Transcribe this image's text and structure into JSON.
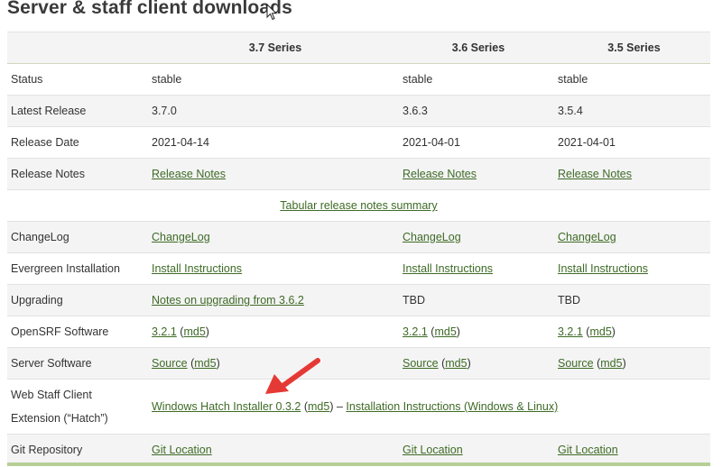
{
  "page": {
    "title": "Server & staff client downloads"
  },
  "table": {
    "columns": [
      "",
      "3.7 Series",
      "3.6 Series",
      "3.5 Series"
    ],
    "rows": {
      "status": {
        "label": "Status",
        "v37": "stable",
        "v36": "stable",
        "v35": "stable"
      },
      "latest_release": {
        "label": "Latest Release",
        "v37": "3.7.0",
        "v36": "3.6.3",
        "v35": "3.5.4"
      },
      "release_date": {
        "label": "Release Date",
        "v37": "2021-04-14",
        "v36": "2021-04-01",
        "v35": "2021-04-01"
      },
      "release_notes": {
        "label": "Release Notes",
        "v37": "Release Notes",
        "v36": "Release Notes",
        "v35": "Release Notes"
      },
      "tabular": {
        "link": "Tabular release notes summary"
      },
      "changelog": {
        "label": "ChangeLog",
        "v37": "ChangeLog",
        "v36": "ChangeLog",
        "v35": "ChangeLog"
      },
      "install": {
        "label": "Evergreen Installation",
        "v37": "Install Instructions",
        "v36": "Install Instructions",
        "v35": "Install Instructions"
      },
      "upgrading": {
        "label": "Upgrading",
        "v37": "Notes on upgrading from 3.6.2",
        "v36": "TBD",
        "v35": "TBD"
      },
      "opensrf": {
        "label": "OpenSRF Software",
        "v37_link": "3.2.1",
        "v37_md5": "md5",
        "v36_link": "3.2.1",
        "v36_md5": "md5",
        "v35_link": "3.2.1",
        "v35_md5": "md5"
      },
      "server": {
        "label": "Server Software",
        "v37_link": "Source",
        "v37_md5": "md5",
        "v36_link": "Source",
        "v36_md5": "md5",
        "v35_link": "Source",
        "v35_md5": "md5"
      },
      "hatch": {
        "label_line1": "Web Staff Client",
        "label_line2": "Extension (“Hatch”)",
        "installer_link": "Windows Hatch Installer 0.3.2",
        "md5_link": "md5",
        "separator": "–",
        "instructions_link": "Installation Instructions (Windows & Linux)"
      },
      "git": {
        "label": "Git Repository",
        "v37": "Git Location",
        "v36": "Git Location",
        "v35": "Git Location"
      }
    }
  },
  "colors": {
    "link": "#3e6b26",
    "stripe": "#f4f4f4",
    "accent_bar": "#b7ce95",
    "arrow": "#e53935"
  },
  "icons": {
    "cursor": "mouse-pointer-icon",
    "annotation": "red-arrow-icon"
  }
}
